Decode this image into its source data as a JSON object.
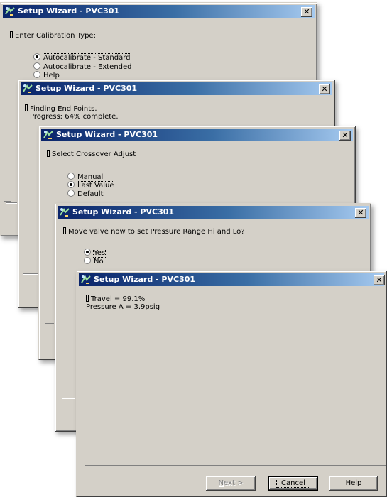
{
  "windows": [
    {
      "title": "Setup Wizard - PVC301",
      "close": "✕",
      "prompt": "Enter Calibration Type:",
      "options": [
        {
          "label": "Autocalibrate - Standard",
          "checked": true
        },
        {
          "label": "Autocalibrate - Extended",
          "checked": false
        },
        {
          "label": "Help",
          "checked": false
        }
      ]
    },
    {
      "title": "Setup Wizard - PVC301",
      "close": "✕",
      "line1": "Finding End Points.",
      "line2": "Progress: 64% complete."
    },
    {
      "title": "Setup Wizard - PVC301",
      "close": "✕",
      "prompt": "Select Crossover Adjust",
      "options": [
        {
          "label": "Manual",
          "checked": false
        },
        {
          "label": "Last Value",
          "checked": true
        },
        {
          "label": "Default",
          "checked": false
        }
      ]
    },
    {
      "title": "Setup Wizard - PVC301",
      "close": "✕",
      "prompt": "Move valve now to set Pressure Range Hi and Lo?",
      "options": [
        {
          "label": "Yes",
          "checked": true
        },
        {
          "label": "No",
          "checked": false
        }
      ]
    },
    {
      "title": "Setup Wizard - PVC301",
      "close": "✕",
      "line1": "Travel = 99.1%",
      "line2": "Pressure A = 3.9psig",
      "buttons": {
        "next_mnemonic": "N",
        "next_rest": "ext >",
        "cancel": "Cancel",
        "help": "Help"
      }
    }
  ]
}
